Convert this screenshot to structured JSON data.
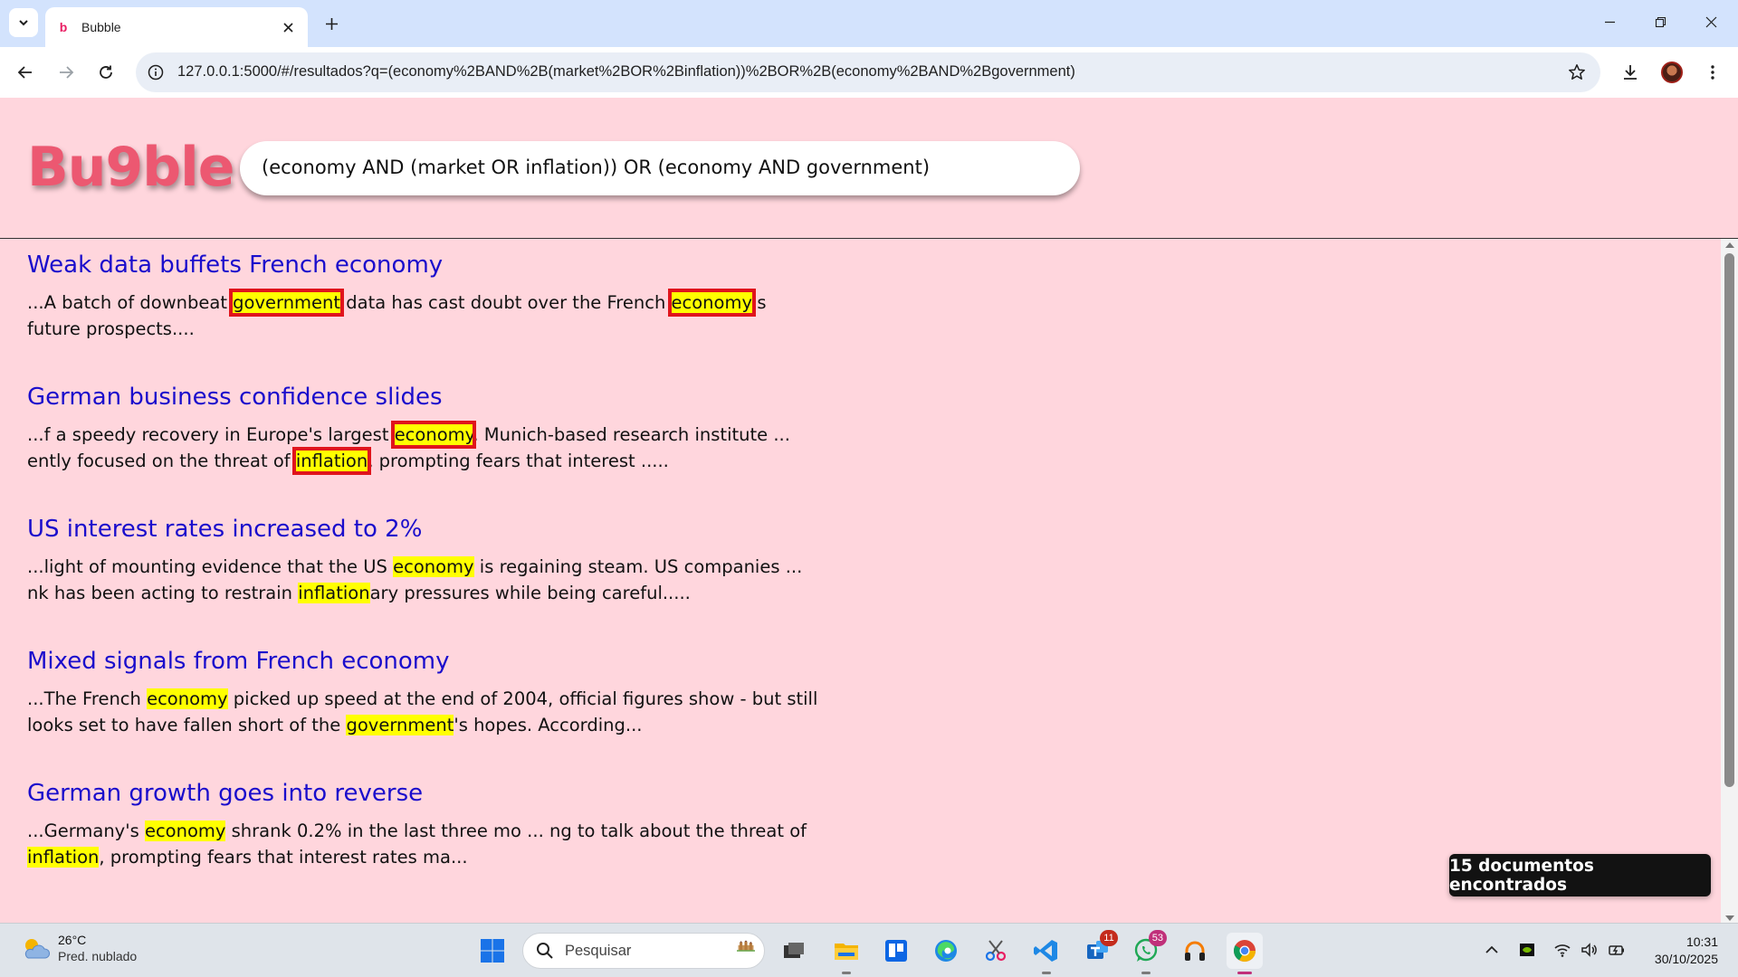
{
  "browser": {
    "tab_title": "Bubble",
    "tab_favicon": "b",
    "url": "127.0.0.1:5000/#/resultados?q=(economy%2BAND%2B(market%2BOR%2Binflation))%2BOR%2B(economy%2BAND%2Bgovernment)"
  },
  "app": {
    "logo": "Bu9ble",
    "search_query": "(economy AND (market OR inflation)) OR (economy AND government)",
    "results_count": "15 documentos encontrados",
    "highlight_color": "#ffff00",
    "title_color": "#1a0dcc",
    "background_color": "#ffd6dd"
  },
  "results": [
    {
      "title": "Weak data buffets French economy",
      "snippet": [
        {
          "t": "...A batch of downbeat "
        },
        {
          "t": "government",
          "hl": true,
          "box": true
        },
        {
          "t": " data has cast doubt over the French "
        },
        {
          "t": "economy",
          "hl": true,
          "box": true
        },
        {
          "t": "'s future prospects...."
        }
      ]
    },
    {
      "title": "German business confidence slides",
      "snippet": [
        {
          "t": "...f a speedy recovery in Europe's largest "
        },
        {
          "t": "economy",
          "hl": true,
          "box": true
        },
        {
          "t": ". Munich-based research institute ... ently focused on the threat of "
        },
        {
          "t": "inflation",
          "hl": true,
          "box": true
        },
        {
          "t": ", prompting fears that interest ....."
        }
      ]
    },
    {
      "title": "US interest rates increased to 2%",
      "snippet": [
        {
          "t": "...light of mounting evidence that the US "
        },
        {
          "t": "economy",
          "hl": true
        },
        {
          "t": " is regaining steam. US companies ... nk has been acting to restrain "
        },
        {
          "t": "inflation",
          "hl": true
        },
        {
          "t": "ary pressures while being careful....."
        }
      ]
    },
    {
      "title": "Mixed signals from French economy",
      "snippet": [
        {
          "t": "...The French "
        },
        {
          "t": "economy",
          "hl": true
        },
        {
          "t": " picked up speed at the end of 2004, official figures show - but still looks set to have fallen short of the "
        },
        {
          "t": "government",
          "hl": true
        },
        {
          "t": "'s hopes. According..."
        }
      ]
    },
    {
      "title": "German growth goes into reverse",
      "snippet": [
        {
          "t": "...Germany's "
        },
        {
          "t": "economy",
          "hl": true
        },
        {
          "t": " shrank 0.2% in the last three mo ... ng to talk about the threat of "
        },
        {
          "t": "inflation",
          "hl": true
        },
        {
          "t": ", prompting fears that interest rates ma..."
        }
      ]
    }
  ],
  "taskbar": {
    "weather_temp": "26°C",
    "weather_desc": "Pred. nublado",
    "search_placeholder": "Pesquisar",
    "time": "10:31",
    "date": "30/10/2025",
    "badges": {
      "teams": "11",
      "whatsapp": "53"
    }
  }
}
